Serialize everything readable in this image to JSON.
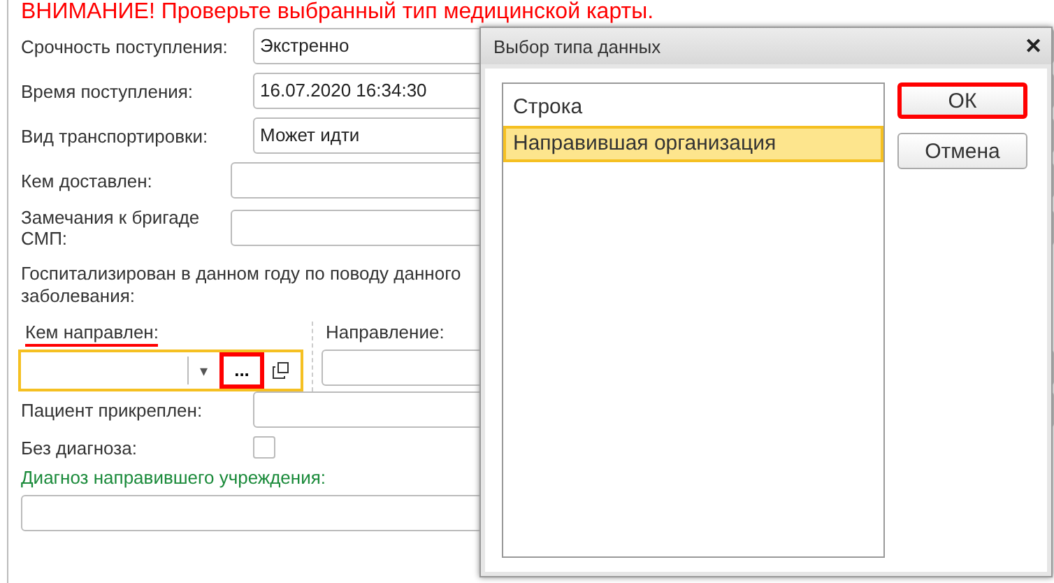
{
  "warning": "ВНИМАНИЕ! Проверьте выбранный тип медицинской карты.",
  "form": {
    "fields": [
      {
        "label": "Срочность поступления:",
        "value": "Экстренно"
      },
      {
        "label": "Время поступления:",
        "value": "16.07.2020 16:34:30"
      },
      {
        "label": "Вид транспортировки:",
        "value": "Может идти"
      },
      {
        "label": "Кем доставлен:"
      },
      {
        "label": "Замечания к бригаде СМП:"
      }
    ],
    "hospitalized_label": "Госпитализирован в данном году по поводу данного заболевания:",
    "referred_by": {
      "label": "Кем направлен:",
      "marked": true,
      "dropdown_icon": "▾",
      "select_button": "...",
      "select_marked": true
    },
    "direction": {
      "label": "Направление:"
    },
    "attached": {
      "label": "Пациент прикреплен:"
    },
    "no_diagnosis": {
      "label": "Без диагноза:",
      "checked": false
    },
    "referral_diagnosis": {
      "label": "Диагноз направившего учреждения:"
    }
  },
  "dialog": {
    "title": "Выбор типа данных",
    "close": "✕",
    "items": [
      {
        "label": "Строка",
        "selected": false
      },
      {
        "label": "Направившая организация",
        "selected": true
      }
    ],
    "buttons": [
      {
        "label": "ОК",
        "marked": true
      },
      {
        "label": "Отмена",
        "marked": false
      }
    ]
  }
}
